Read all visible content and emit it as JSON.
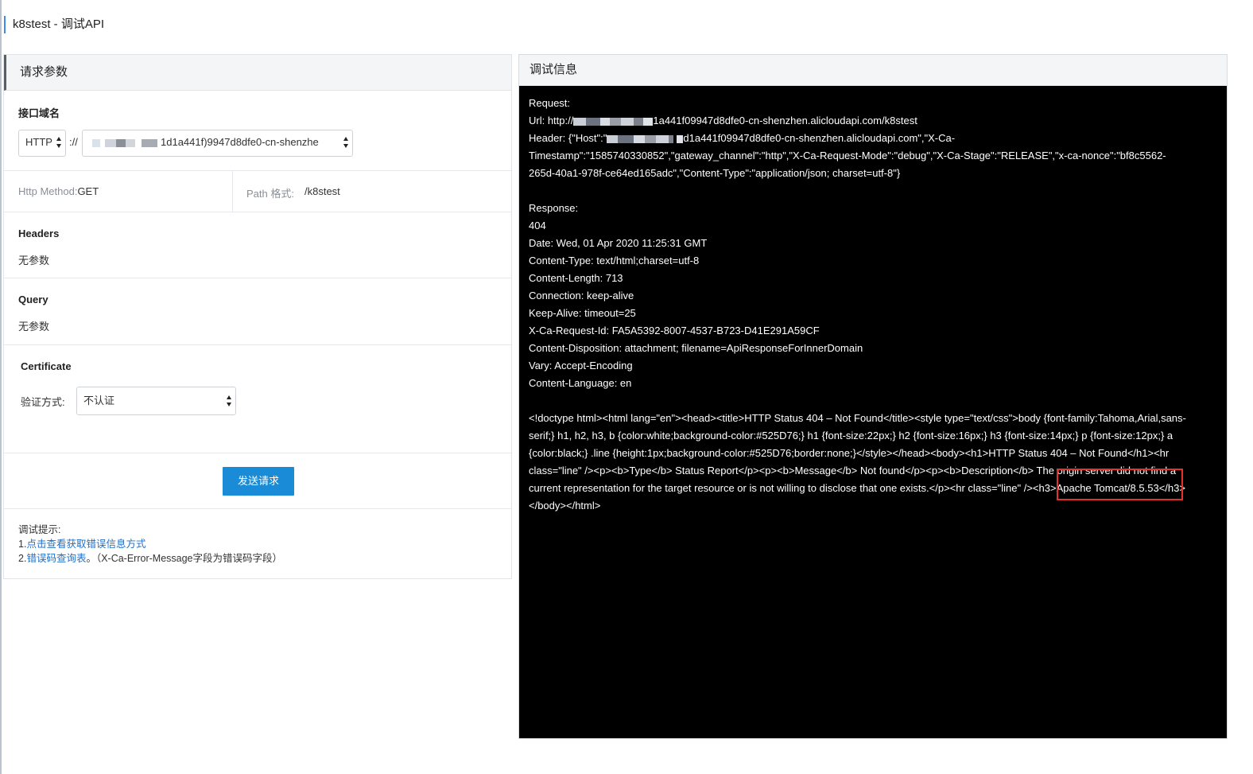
{
  "page": {
    "title": "k8stest - 调试API"
  },
  "request_panel": {
    "header": "请求参数",
    "endpoint": {
      "label": "接口域名",
      "protocol": "HTTP",
      "separator": "://",
      "domain_suffix": "1d1a441f)9947d8dfe0-cn-shenzhe"
    },
    "method": {
      "label": "Http Method:",
      "value": "GET"
    },
    "path": {
      "label": "Path 格式:",
      "value": "/k8stest"
    },
    "headers": {
      "label": "Headers",
      "value": "无参数"
    },
    "query": {
      "label": "Query",
      "value": "无参数"
    },
    "certificate": {
      "label": "Certificate",
      "auth_label": "验证方式:",
      "auth_value": "不认证"
    },
    "send_button": "发送请求",
    "tips": {
      "title": "调试提示:",
      "item1_prefix": "1.",
      "item1_link": "点击查看获取错误信息方式",
      "item2_prefix": "2.",
      "item2_link": "错误码查询表",
      "item2_suffix": "。（X-Ca-Error-Message字段为错误码字段）"
    }
  },
  "debug_panel": {
    "header": "调试信息",
    "request_label": "Request:",
    "url_prefix": "Url: http://",
    "url_suffix": "1a441f09947d8dfe0-cn-shenzhen.alicloudapi.com/k8stest",
    "header_prefix": "Header: {\"Host\":\"",
    "header_suffix": "d1a441f09947d8dfe0-cn-shenzhen.alicloudapi.com\",\"X-Ca-",
    "header_cont": "Timestamp\":\"1585740330852\",\"gateway_channel\":\"http\",\"X-Ca-Request-Mode\":\"debug\",\"X-Ca-Stage\":\"RELEASE\",\"x-ca-nonce\":\"bf8c5562-",
    "header_cont2": "265d-40a1-978f-ce64ed165adc\",\"Content-Type\":\"application/json; charset=utf-8\"}",
    "response_lines": [
      "Response:",
      "404",
      "Date: Wed, 01 Apr 2020 11:25:31 GMT",
      "Content-Type: text/html;charset=utf-8",
      "Content-Length: 713",
      "Connection: keep-alive",
      "Keep-Alive: timeout=25",
      "X-Ca-Request-Id: FA5A5392-8007-4537-B723-D41E291A59CF",
      "Content-Disposition: attachment; filename=ApiResponseForInnerDomain",
      "Vary: Accept-Encoding",
      "Content-Language: en"
    ],
    "body_lines": [
      "<!doctype html><html lang=\"en\"><head><title>HTTP Status 404 – Not Found</title><style type=\"text/css\">body {font-family:Tahoma,Arial,sans-",
      "serif;} h1, h2, h3, b {color:white;background-color:#525D76;} h1 {font-size:22px;} h2 {font-size:16px;} h3 {font-size:14px;} p {font-size:12px;} a",
      "{color:black;} .line {height:1px;background-color:#525D76;border:none;}</style></head><body><h1>HTTP Status 404 – Not Found</h1><hr",
      "class=\"line\" /><p><b>Type</b> Status Report</p><p><b>Message</b> Not found</p><p><b>Description</b> The origin server did not find a",
      "current representation for the target resource or is not willing to disclose that one exists.</p><hr class=\"line\" /><h3>Apache Tomcat/8.5.53</h3>",
      "</body></html>"
    ]
  }
}
